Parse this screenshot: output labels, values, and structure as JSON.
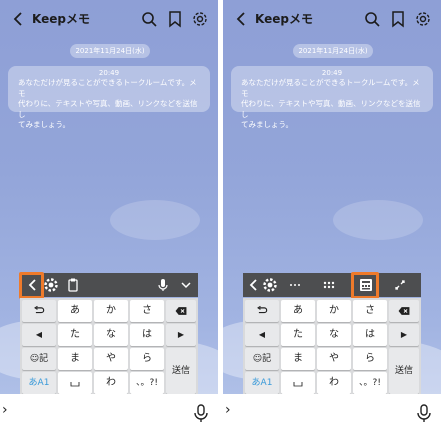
{
  "header": {
    "title": "Keepメモ"
  },
  "chat": {
    "date": "2021年11月24日(水)",
    "time": "20:49",
    "message_line1": "あなただけが見ることができるトークルームです。メモ",
    "message_line2": "代わりに、テキストや写真、動画、リンクなどを送信し",
    "message_line3": "てみましょう。"
  },
  "keyboard": {
    "row1": [
      "あ",
      "か",
      "さ"
    ],
    "row2": [
      "た",
      "な",
      "は"
    ],
    "row3": [
      "ま",
      "や",
      "ら"
    ],
    "row4": [
      "わ",
      "、。?!"
    ],
    "emoji_key": "☺記",
    "mode_key": "あA1",
    "send_key": "送信",
    "left_arrow": "◀",
    "right_arrow": "▶"
  },
  "input": {
    "expand_label": "›"
  },
  "colors": {
    "highlight": "#ee7a2b",
    "toolbar": "#4d4e50",
    "mode_key_text": "#3a9ad9"
  }
}
